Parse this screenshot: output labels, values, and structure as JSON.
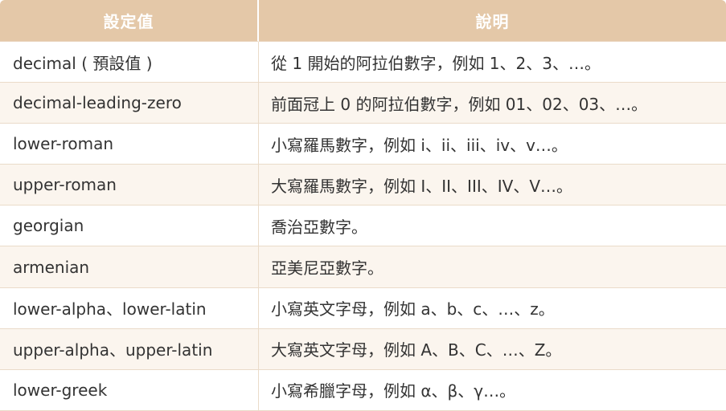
{
  "table": {
    "headers": [
      "設定值",
      "說明"
    ],
    "rows": [
      {
        "value": "decimal ( 預設值 )",
        "description": "從 1 開始的阿拉伯數字，例如 1、2、3、…。"
      },
      {
        "value": "decimal-leading-zero",
        "description": "前面冠上 0 的阿拉伯數字，例如 01、02、03、…。"
      },
      {
        "value": "lower-roman",
        "description": "小寫羅馬數字，例如 i、ii、iii、iv、v…。"
      },
      {
        "value": "upper-roman",
        "description": "大寫羅馬數字，例如 I、II、III、IV、V…。"
      },
      {
        "value": "georgian",
        "description": "喬治亞數字。"
      },
      {
        "value": "armenian",
        "description": "亞美尼亞數字。"
      },
      {
        "value": "lower-alpha、lower-latin",
        "description": "小寫英文字母，例如 a、b、c、…、z。"
      },
      {
        "value": "upper-alpha、upper-latin",
        "description": "大寫英文字母，例如 A、B、C、…、Z。"
      },
      {
        "value": "lower-greek",
        "description": "小寫希臘字母，例如 α、β、γ…。"
      }
    ]
  },
  "colors": {
    "header_bg": "#e4c8a8",
    "header_text": "#ffffff",
    "row_alt_bg": "#fbf5ee",
    "border": "#eadbc9",
    "body_text": "#333333"
  }
}
